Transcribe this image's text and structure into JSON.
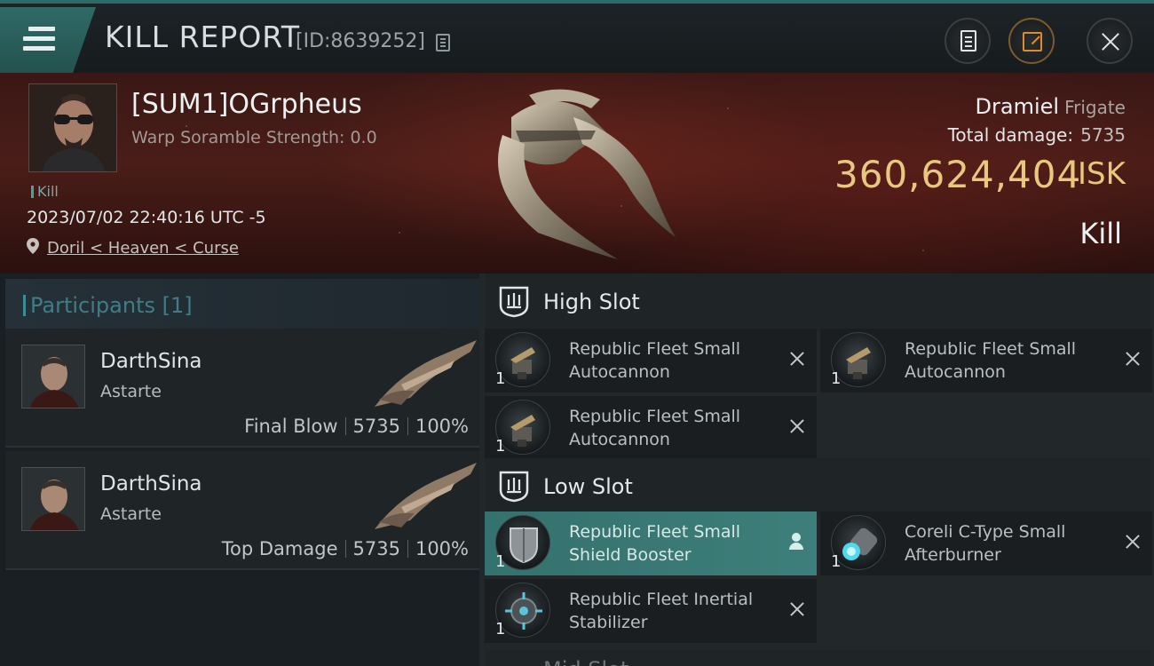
{
  "header": {
    "title": "KILL REPORT",
    "id_label": "[ID:8639252]"
  },
  "victim": {
    "name": "[SUM1]OGrpheus",
    "scramble": "Warp Soramble Strength: 0.0",
    "tag": "Kill",
    "time": "2023/07/02 22:40:16 UTC -5",
    "location": "Doril < Heaven < Curse"
  },
  "ship": {
    "name": "Dramiel",
    "class": "Frigate",
    "total_damage_label": "Total damage:",
    "total_damage": "5735",
    "isk_value": "360,624,404",
    "isk_unit": "ISK",
    "result": "Kill"
  },
  "participants": {
    "header": "Participants [1]",
    "rows": [
      {
        "name": "DarthSina",
        "ship": "Astarte",
        "role": "Final Blow",
        "damage": "5735",
        "percent": "100%"
      },
      {
        "name": "DarthSina",
        "ship": "Astarte",
        "role": "Top Damage",
        "damage": "5735",
        "percent": "100%"
      }
    ]
  },
  "fitting": {
    "high_slot": {
      "title": "High Slot",
      "modules": [
        {
          "name_line1": "Republic Fleet Small",
          "name_line2": "Autocannon",
          "qty": "1"
        },
        {
          "name_line1": "Republic Fleet Small",
          "name_line2": "Autocannon",
          "qty": "1"
        },
        {
          "name_line1": "Republic Fleet Small",
          "name_line2": "Autocannon",
          "qty": "1"
        }
      ]
    },
    "low_slot": {
      "title": "Low Slot",
      "modules": [
        {
          "name_line1": "Republic Fleet Small",
          "name_line2": "Shield Booster",
          "qty": "1"
        },
        {
          "name_line1": "Coreli C-Type Small",
          "name_line2": "Afterburner",
          "qty": "1"
        },
        {
          "name_line1": "Republic Fleet Inertial",
          "name_line2": "Stabilizer",
          "qty": "1"
        }
      ]
    },
    "mid_slot": {
      "title": "Mid Slot"
    }
  },
  "icons": {
    "menu": "hamburger-icon",
    "copy": "copy-icon",
    "report": "clipboard-icon",
    "share": "share-icon",
    "close": "close-icon",
    "location": "map-pin-icon",
    "slot": "slot-shield-icon",
    "remove": "x-icon",
    "owner": "user-icon"
  },
  "colors": {
    "accent": "#2f6a67",
    "isk": "#e8c77e",
    "share_accent": "#e08a2c",
    "highlight_row": "#3d7f7a"
  }
}
